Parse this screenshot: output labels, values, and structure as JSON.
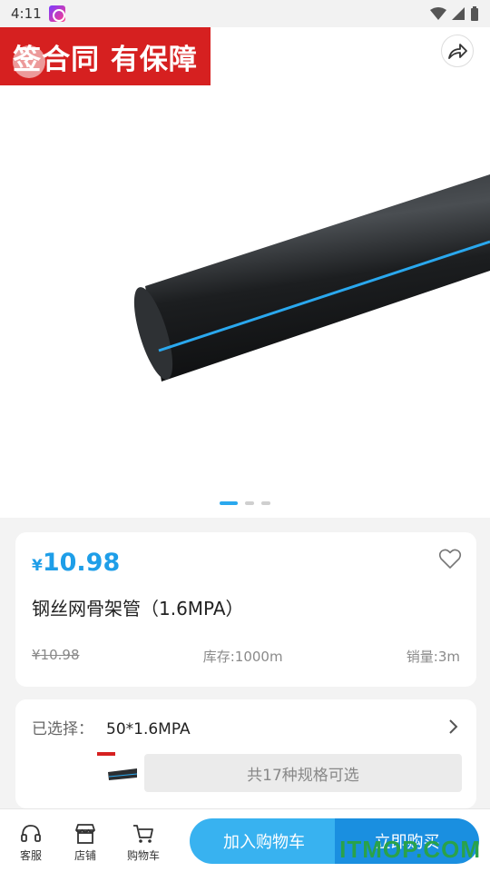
{
  "status_bar": {
    "time": "4:11"
  },
  "hero": {
    "promo_text": "签合同 有保障",
    "active_slide": 1,
    "slide_count": 3
  },
  "product": {
    "price_symbol": "¥",
    "price": "10.98",
    "title": "钢丝网骨架管（1.6MPA）",
    "original_price": "¥10.98",
    "stock": "库存:1000m",
    "sales": "销量:3m"
  },
  "spec": {
    "label": "已选择：",
    "value": "50*1.6MPA",
    "count_text": "共17种规格可选"
  },
  "bottom_nav": {
    "service": "客服",
    "shop": "店铺",
    "cart": "购物车",
    "add_to_cart": "加入购物车",
    "buy_now": "立即购买"
  },
  "watermark": "ITMOP.COM",
  "colors": {
    "accent": "#1e9ee8",
    "promo": "#d62020",
    "cart_button": "#38b2f0",
    "buy_button": "#1a8fe0"
  }
}
